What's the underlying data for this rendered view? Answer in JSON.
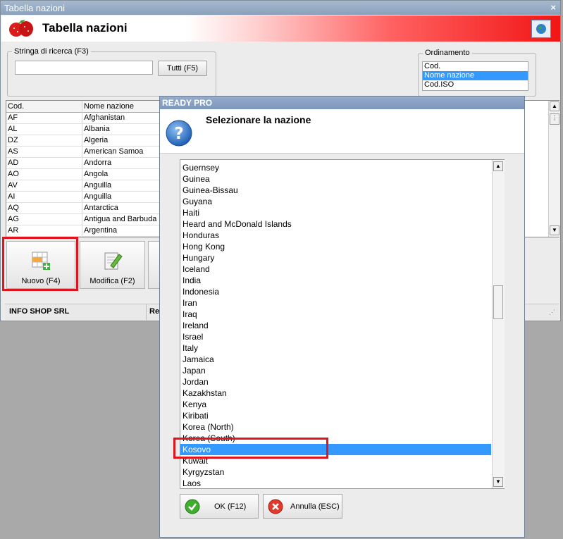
{
  "main_window": {
    "title": "Tabella nazioni",
    "close_glyph": "×",
    "banner_title": "Tabella nazioni",
    "search_group_label": "Stringa di ricerca (F3)",
    "search_value": "",
    "tutti_button": "Tutti (F5)",
    "sort_group_label": "Ordinamento",
    "sort_options": [
      {
        "label": "Cod.",
        "selected": false
      },
      {
        "label": "Nome nazione",
        "selected": true
      },
      {
        "label": "Cod.ISO",
        "selected": false
      }
    ],
    "grid": {
      "headers": [
        "Cod.",
        "Nome nazione"
      ],
      "rows": [
        {
          "code": "AF",
          "name": "Afghanistan"
        },
        {
          "code": "AL",
          "name": "Albania"
        },
        {
          "code": "DZ",
          "name": "Algeria"
        },
        {
          "code": "AS",
          "name": "American Samoa"
        },
        {
          "code": "AD",
          "name": "Andorra"
        },
        {
          "code": "AO",
          "name": "Angola"
        },
        {
          "code": "AV",
          "name": "Anguilla"
        },
        {
          "code": "AI",
          "name": "Anguilla"
        },
        {
          "code": "AQ",
          "name": "Antarctica"
        },
        {
          "code": "AG",
          "name": "Antigua and Barbuda"
        },
        {
          "code": "AR",
          "name": "Argentina"
        }
      ]
    },
    "toolbar": {
      "new_label": "Nuovo (F4)",
      "edit_label": "Modifica (F2)"
    },
    "status": {
      "company": "INFO SHOP SRL",
      "partial": "Re"
    }
  },
  "dialog": {
    "title": "READY PRO",
    "message": "Selezionare la nazione",
    "nations": [
      "Guernsey",
      "Guinea",
      "Guinea-Bissau",
      "Guyana",
      "Haiti",
      "Heard and McDonald Islands",
      "Honduras",
      "Hong Kong",
      "Hungary",
      "Iceland",
      "India",
      "Indonesia",
      "Iran",
      "Iraq",
      "Ireland",
      "Israel",
      "Italy",
      "Jamaica",
      "Japan",
      "Jordan",
      "Kazakhstan",
      "Kenya",
      "Kiribati",
      "Korea (North)",
      "Korea (South)",
      "Kosovo",
      "Kuwait",
      "Kyrgyzstan",
      "Laos"
    ],
    "selected_nation": "Kosovo",
    "ok_label": "OK (F12)",
    "cancel_label": "Annulla (ESC)"
  },
  "icons": {
    "strawberry": "strawberry-icon",
    "globe": "globe-icon",
    "question": "question-icon",
    "new": "new-record-icon",
    "edit": "edit-icon",
    "ok": "check-icon",
    "cancel": "cancel-icon"
  },
  "colors": {
    "selection": "#3399ff",
    "highlight": "#e0141c",
    "banner_red": "#f21515",
    "title_bar": "#8aa0ba"
  }
}
